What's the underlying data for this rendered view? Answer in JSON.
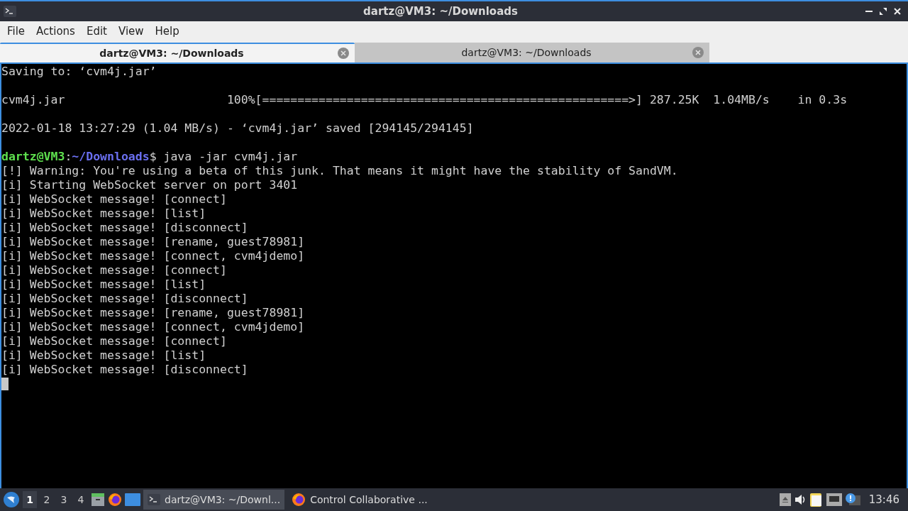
{
  "window": {
    "title": "dartz@VM3: ~/Downloads"
  },
  "menu": [
    "File",
    "Actions",
    "Edit",
    "View",
    "Help"
  ],
  "tabs": [
    {
      "label": "dartz@VM3: ~/Downloads",
      "selected": true
    },
    {
      "label": "dartz@VM3: ~/Downloads",
      "selected": false
    }
  ],
  "terminal": {
    "lines": [
      {
        "kind": "text",
        "text": "Saving to: ‘cvm4j.jar’"
      },
      {
        "kind": "blank"
      },
      {
        "kind": "text",
        "text": "cvm4j.jar                       100%[====================================================>] 287.25K  1.04MB/s    in 0.3s"
      },
      {
        "kind": "blank"
      },
      {
        "kind": "text",
        "text": "2022-01-18 13:27:29 (1.04 MB/s) - ‘cvm4j.jar’ saved [294145/294145]"
      },
      {
        "kind": "blank"
      },
      {
        "kind": "prompt",
        "user_host": "dartz@VM3",
        "separator": ":",
        "path": "~/Downloads",
        "symbol": "$",
        "command": " java -jar cvm4j.jar"
      },
      {
        "kind": "text",
        "text": "[!] Warning: You're using a beta of this junk. That means it might have the stability of SandVM."
      },
      {
        "kind": "text",
        "text": "[i] Starting WebSocket server on port 3401"
      },
      {
        "kind": "text",
        "text": "[i] WebSocket message! [connect]"
      },
      {
        "kind": "text",
        "text": "[i] WebSocket message! [list]"
      },
      {
        "kind": "text",
        "text": "[i] WebSocket message! [disconnect]"
      },
      {
        "kind": "text",
        "text": "[i] WebSocket message! [rename, guest78981]"
      },
      {
        "kind": "text",
        "text": "[i] WebSocket message! [connect, cvm4jdemo]"
      },
      {
        "kind": "text",
        "text": "[i] WebSocket message! [connect]"
      },
      {
        "kind": "text",
        "text": "[i] WebSocket message! [list]"
      },
      {
        "kind": "text",
        "text": "[i] WebSocket message! [disconnect]"
      },
      {
        "kind": "text",
        "text": "[i] WebSocket message! [rename, guest78981]"
      },
      {
        "kind": "text",
        "text": "[i] WebSocket message! [connect, cvm4jdemo]"
      },
      {
        "kind": "text",
        "text": "[i] WebSocket message! [connect]"
      },
      {
        "kind": "text",
        "text": "[i] WebSocket message! [list]"
      },
      {
        "kind": "text",
        "text": "[i] WebSocket message! [disconnect]"
      },
      {
        "kind": "cursor"
      }
    ]
  },
  "taskbar": {
    "desktops": [
      {
        "label": "1",
        "selected": true
      },
      {
        "label": "2",
        "selected": false
      },
      {
        "label": "3",
        "selected": false
      },
      {
        "label": "4",
        "selected": false
      }
    ],
    "tasks": [
      {
        "kind": "terminal",
        "label": "dartz@VM3: ~/Downl...",
        "selected": true
      },
      {
        "kind": "browser",
        "label": "Control Collaborative ...",
        "selected": false
      }
    ],
    "clock": "13:46"
  }
}
